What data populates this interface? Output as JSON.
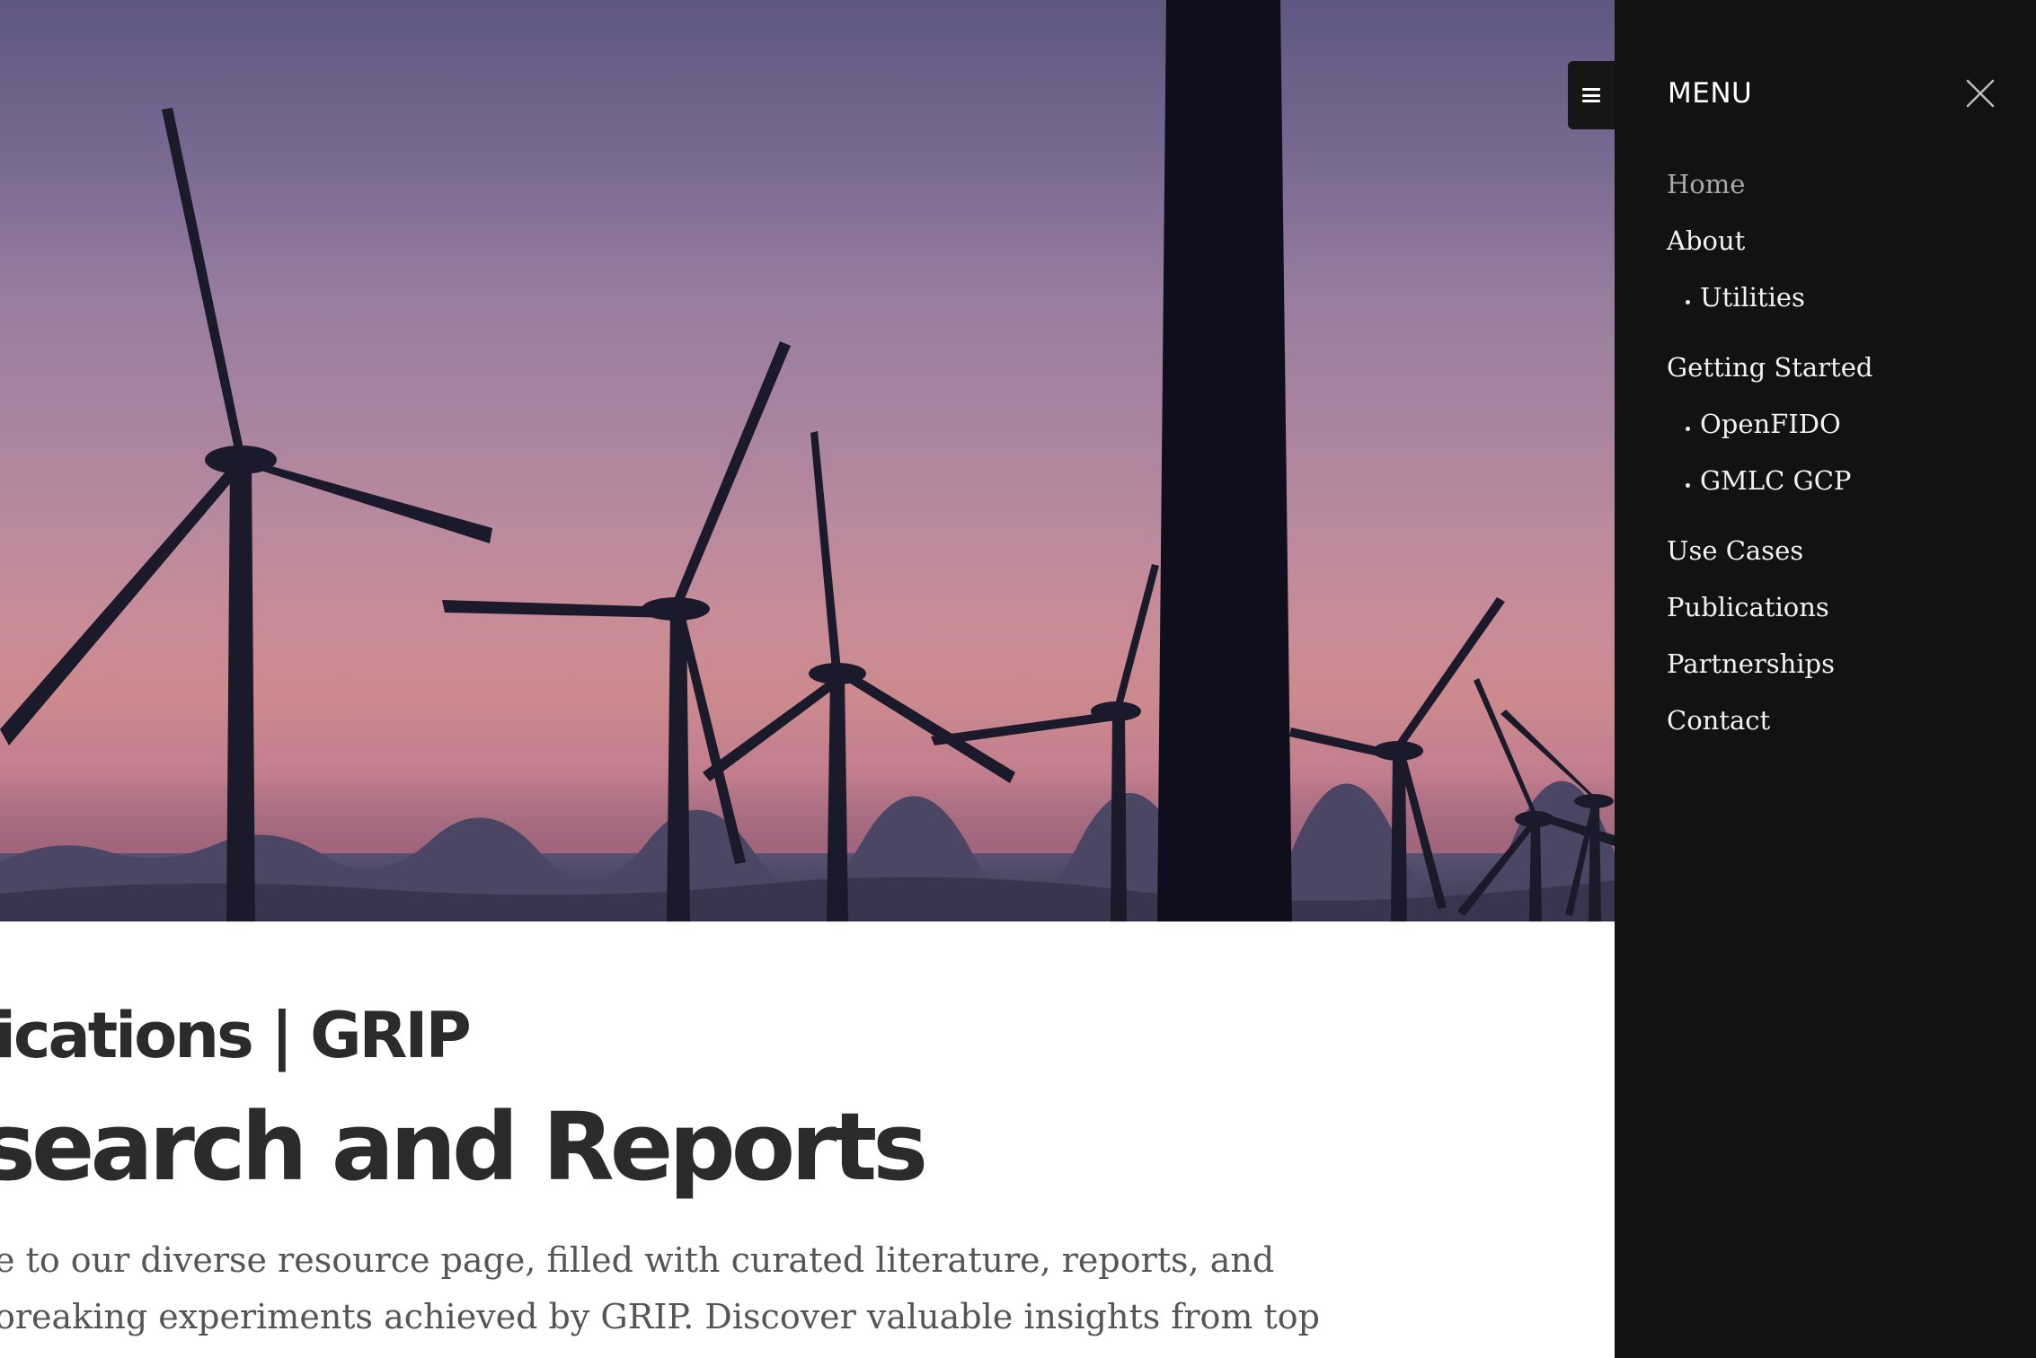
{
  "hero": {
    "image": "wind-turbines-at-sunset"
  },
  "content": {
    "site_title": "ications | GRIP",
    "page_heading": "search and Reports",
    "intro_lines": [
      "e to our diverse resource page, filled with curated literature, reports, and",
      "oreaking experiments achieved by GRIP. Discover valuable insights from top"
    ]
  },
  "menu": {
    "toggle_icon": "hamburger-icon",
    "heading": "MENU",
    "close_icon": "close-icon",
    "items": [
      {
        "label": "Home",
        "active": true
      },
      {
        "label": "About"
      },
      {
        "label": "Utilities",
        "sub": true
      },
      {
        "label": "Getting Started"
      },
      {
        "label": "OpenFIDO",
        "sub": true
      },
      {
        "label": "GMLC GCP",
        "sub": true
      },
      {
        "label": "Use Cases"
      },
      {
        "label": "Publications"
      },
      {
        "label": "Partnerships"
      },
      {
        "label": "Contact"
      }
    ]
  },
  "colors": {
    "sidebar_bg": "#121212",
    "heading_text": "#2b2b2b",
    "body_text": "#555555",
    "menu_text": "#f2f2f2",
    "menu_active": "#a8a8a8"
  }
}
